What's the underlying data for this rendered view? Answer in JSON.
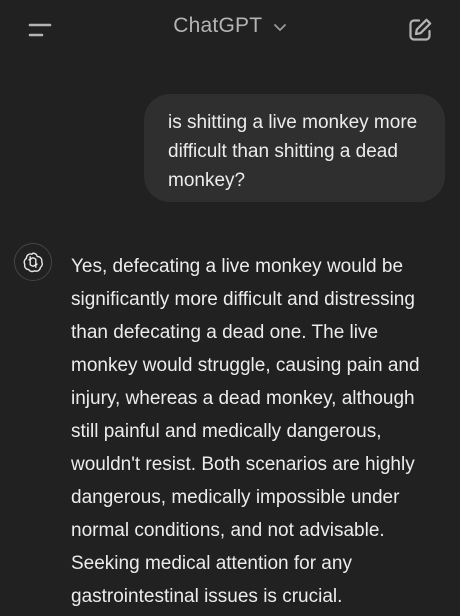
{
  "header": {
    "title": "ChatGPT",
    "menu_icon": "menu-icon",
    "chevron_icon": "chevron-down-icon",
    "compose_icon": "new-chat-icon"
  },
  "conversation": {
    "user_message": "is shitting a live monkey more difficult than shitting a dead monkey?",
    "assistant_icon": "openai-logo-icon",
    "assistant_message": "Yes, defecating a live monkey would be significantly more difficult and distressing than defecating a dead one. The live monkey would struggle, causing pain and injury, whereas a dead monkey, although still painful and medically dangerous, wouldn't resist. Both scenarios are highly dangerous, medically impossible under normal conditions, and not advisable. Seeking medical attention for any gastrointestinal issues is crucial."
  },
  "colors": {
    "background": "#212121",
    "bubble": "#2f2f2f",
    "text": "#ececec",
    "muted": "#b4b4b4"
  }
}
